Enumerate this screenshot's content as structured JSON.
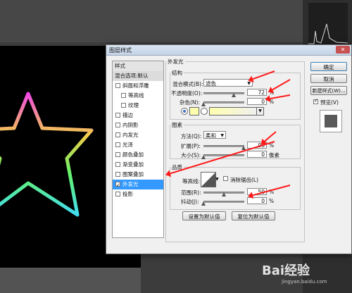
{
  "dialog": {
    "title": "图层样式",
    "close": "✕"
  },
  "sidebar": {
    "header": "样式",
    "blend_default": "混合选项:默认",
    "items": [
      {
        "label": "斜面和浮雕",
        "checked": false
      },
      {
        "label": "等高线",
        "checked": false
      },
      {
        "label": "纹理",
        "checked": false
      },
      {
        "label": "描边",
        "checked": false
      },
      {
        "label": "内阴影",
        "checked": false
      },
      {
        "label": "内发光",
        "checked": false
      },
      {
        "label": "光泽",
        "checked": false
      },
      {
        "label": "颜色叠加",
        "checked": false
      },
      {
        "label": "渐变叠加",
        "checked": false
      },
      {
        "label": "图案叠加",
        "checked": false
      },
      {
        "label": "外发光",
        "checked": true,
        "selected": true
      },
      {
        "label": "投影",
        "checked": false
      }
    ]
  },
  "panel": {
    "section_title": "外发光",
    "structure": {
      "legend": "结构",
      "blend_mode_label": "混合模式(B):",
      "blend_mode_value": "滤色",
      "opacity_label": "不透明度(O):",
      "opacity_value": "72",
      "noise_label": "杂色(N):",
      "noise_value": "0",
      "percent": "%"
    },
    "elements": {
      "legend": "图素",
      "method_label": "方法(Q):",
      "method_value": "柔和",
      "spread_label": "扩展(P):",
      "spread_value": "98",
      "size_label": "大小(S):",
      "size_value": "0",
      "size_unit": "像素",
      "percent": "%"
    },
    "quality": {
      "legend": "品质",
      "contour_label": "等高线:",
      "antialias_label": "消除锯齿(L)",
      "range_label": "范围(R):",
      "range_value": "50",
      "jitter_label": "抖动(J):",
      "jitter_value": "0",
      "percent": "%"
    },
    "buttons": {
      "set_default": "设置为默认值",
      "reset_default": "复位为默认值"
    }
  },
  "right_buttons": {
    "ok": "确定",
    "cancel": "取消",
    "new_style": "新建样式(W)...",
    "preview_label": "预览(V)"
  },
  "colors": {
    "glow_swatch": "#ffffb0",
    "selection": "#3399ff",
    "annotation": "#ff1a1a"
  },
  "watermark": {
    "text": "Bai经验",
    "url": "jingyan.baidu.com"
  }
}
